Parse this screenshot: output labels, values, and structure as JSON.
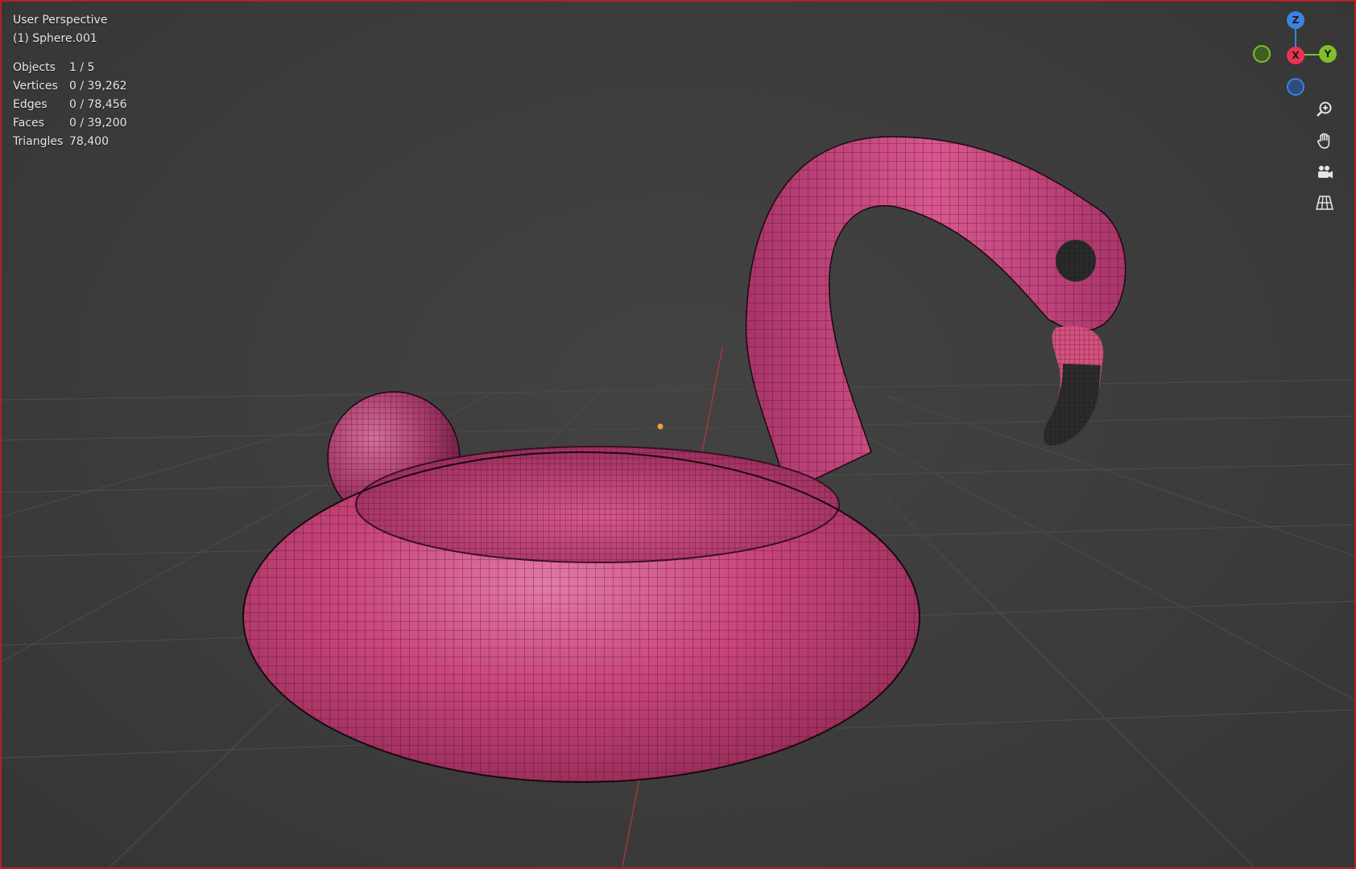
{
  "viewport": {
    "view_name": "User Perspective",
    "active_object": "(1) Sphere.001"
  },
  "stats": {
    "objects": {
      "label": "Objects",
      "value": "1 / 5"
    },
    "vertices": {
      "label": "Vertices",
      "value": "0 / 39,262"
    },
    "edges": {
      "label": "Edges",
      "value": "0 / 78,456"
    },
    "faces": {
      "label": "Faces",
      "value": "0 / 39,200"
    },
    "triangles": {
      "label": "Triangles",
      "value": "78,400"
    }
  },
  "gizmo": {
    "z_label": "Z",
    "x_label": "X",
    "y_label": "Y",
    "colors": {
      "x": "#e8344f",
      "y": "#7fbf2a",
      "z": "#3a84e0"
    }
  },
  "nav_icons": [
    "zoom-icon",
    "pan-hand-icon",
    "camera-icon",
    "perspective-grid-icon"
  ],
  "colors": {
    "background": "#3d3d3d",
    "mesh_pink": "#c9457a",
    "beak_dark": "#2b2b2b",
    "border": "#b32121"
  }
}
